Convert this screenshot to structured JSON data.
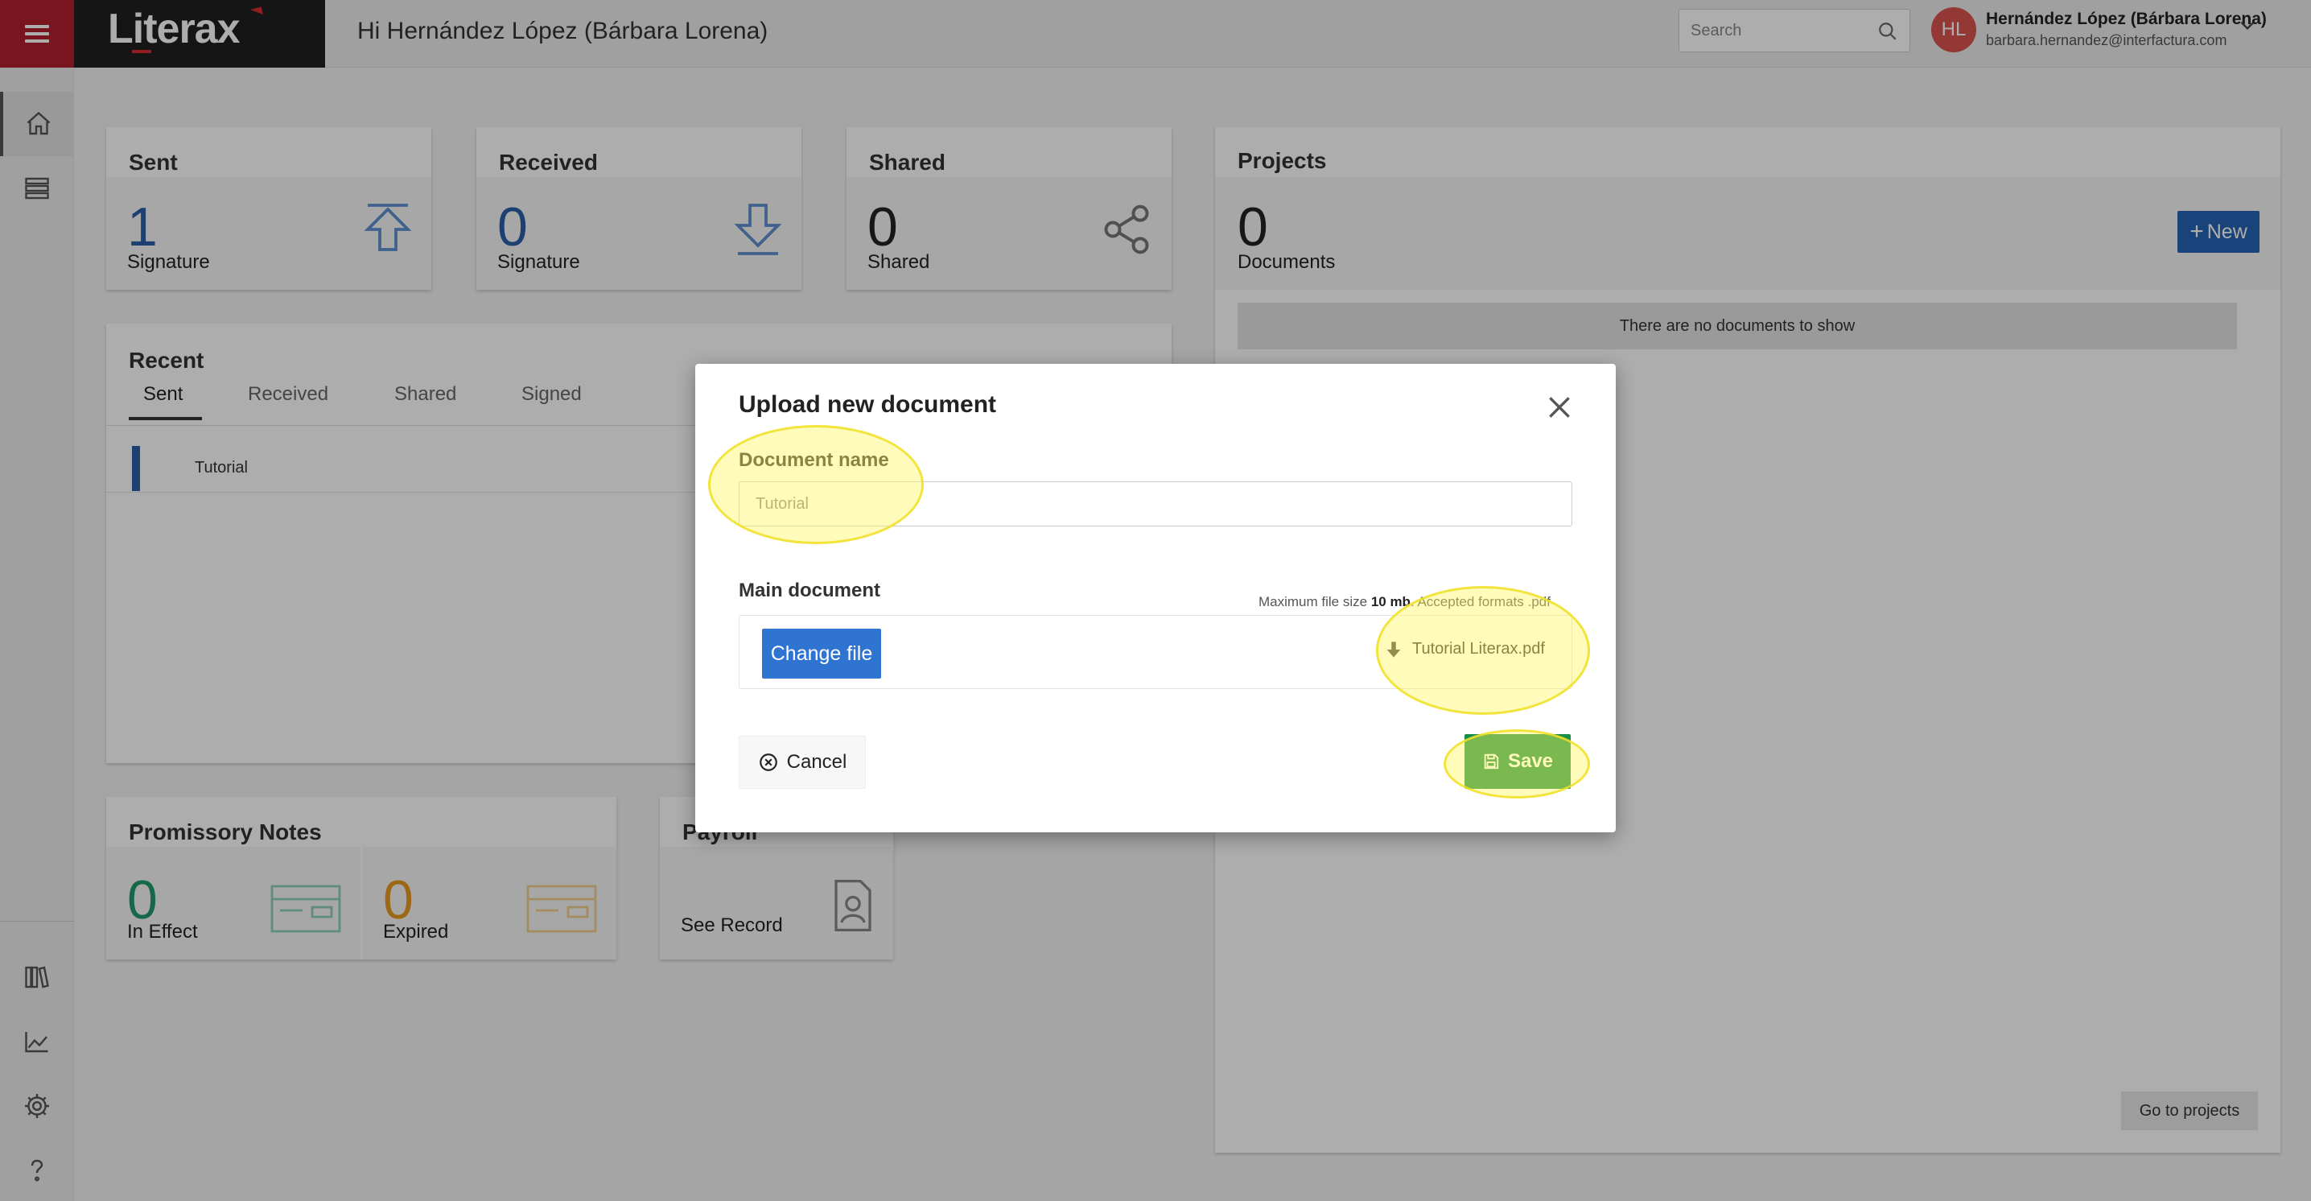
{
  "header": {
    "logo": "Literax",
    "greeting": "Hi Hernández López (Bárbara Lorena)",
    "search_placeholder": "Search",
    "avatar_initials": "HL",
    "user_name": "Hernández López (Bárbara Lorena)",
    "user_email": "barbara.hernandez@interfactura.com"
  },
  "sidebar": {
    "top_items": [
      {
        "icon": "home-icon"
      },
      {
        "icon": "table-icon"
      }
    ],
    "bottom_items": [
      {
        "icon": "library-icon"
      },
      {
        "icon": "chart-icon"
      },
      {
        "icon": "gear-icon"
      },
      {
        "icon": "help-icon"
      }
    ]
  },
  "cards": {
    "sent": {
      "title": "Sent",
      "count": "1",
      "label": "Signature",
      "icon": "upload-arrow-icon"
    },
    "received": {
      "title": "Received",
      "count": "0",
      "label": "Signature",
      "icon": "download-arrow-icon"
    },
    "shared": {
      "title": "Shared",
      "count": "0",
      "label": "Shared",
      "icon": "share-icon"
    },
    "recent": {
      "title": "Recent",
      "tabs": [
        "Sent",
        "Received",
        "Shared",
        "Signed"
      ],
      "active_tab": "Sent",
      "rows": [
        "Tutorial"
      ]
    },
    "promissory": {
      "title": "Promissory Notes",
      "in_effect_count": "0",
      "in_effect_label": "In Effect",
      "expired_count": "0",
      "expired_label": "Expired"
    },
    "payroll": {
      "title": "Payroll",
      "label": "See Record"
    },
    "projects": {
      "title": "Projects",
      "count": "0",
      "label": "Documents",
      "new_label": "New",
      "empty_text": "There are no documents to show",
      "goto_label": "Go to projects"
    }
  },
  "colors": {
    "brand_red": "#b21f2d",
    "sent_blue": "#2c5fa8",
    "in_effect_green": "#1f9a6a",
    "expired_orange": "#e69a1f",
    "save_green": "#1a8d48",
    "primary_blue": "#2f74d0"
  },
  "modal": {
    "title": "Upload new document",
    "doc_name_label": "Document name",
    "doc_name_value": "Tutorial",
    "main_doc_label": "Main document",
    "file_note_prefix": "Maximum file size ",
    "file_note_size": "10 mb",
    "file_note_suffix": ". Accepted formats .pdf",
    "change_file_label": "Change file",
    "file_name": "Tutorial Literax.pdf",
    "cancel_label": "Cancel",
    "save_label": "Save"
  }
}
